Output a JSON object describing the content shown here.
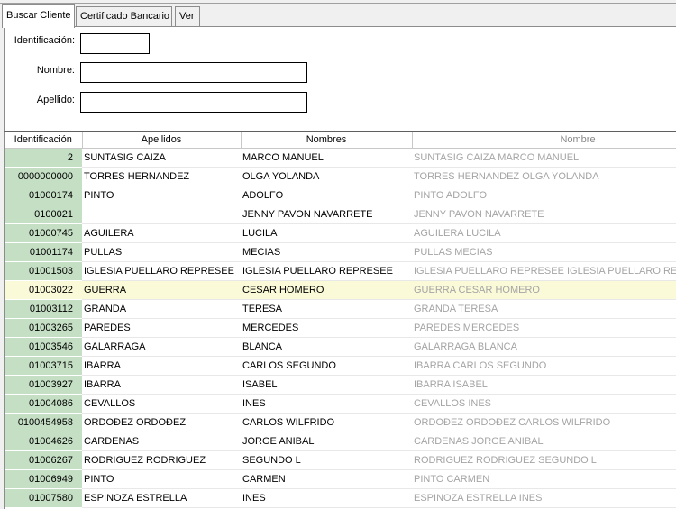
{
  "tabs": [
    {
      "label": "Buscar Cliente",
      "active": true
    },
    {
      "label": "Certificado Bancario",
      "active": false
    },
    {
      "label": "Ver",
      "active": false
    }
  ],
  "form": {
    "identificacion_label": "Identificación:",
    "identificacion_value": "",
    "nombre_label": "Nombre:",
    "nombre_value": "",
    "apellido_label": "Apellido:",
    "apellido_value": ""
  },
  "grid": {
    "headers": [
      "Identificación",
      "Apellidos",
      "Nombres",
      "Nombre"
    ],
    "selected_index": 7,
    "rows": [
      [
        "2",
        "SUNTASIG CAIZA",
        "MARCO MANUEL",
        "SUNTASIG CAIZA MARCO MANUEL"
      ],
      [
        "0000000000",
        "TORRES HERNANDEZ",
        "OLGA YOLANDA",
        "TORRES HERNANDEZ OLGA YOLANDA"
      ],
      [
        "01000174",
        "PINTO",
        "ADOLFO",
        "PINTO  ADOLFO"
      ],
      [
        "0100021",
        "",
        "JENNY PAVON NAVARRETE",
        " JENNY PAVON NAVARRETE"
      ],
      [
        "01000745",
        "AGUILERA",
        "LUCILA",
        "AGUILERA  LUCILA"
      ],
      [
        "01001174",
        "PULLAS",
        "MECIAS",
        "PULLAS  MECIAS"
      ],
      [
        "01001503",
        "IGLESIA PUELLARO REPRESEE",
        "IGLESIA PUELLARO REPRESEE",
        "IGLESIA PUELLARO REPRESEE IGLESIA PUELLARO REPRESEE"
      ],
      [
        "01003022",
        "GUERRA",
        "CESAR HOMERO",
        "GUERRA  CESAR HOMERO"
      ],
      [
        "01003112",
        "GRANDA",
        "TERESA",
        "GRANDA  TERESA"
      ],
      [
        "01003265",
        "PAREDES",
        "MERCEDES",
        "PAREDES  MERCEDES"
      ],
      [
        "01003546",
        "GALARRAGA",
        "BLANCA",
        "GALARRAGA  BLANCA"
      ],
      [
        "01003715",
        "IBARRA",
        "CARLOS SEGUNDO",
        "IBARRA  CARLOS SEGUNDO"
      ],
      [
        "01003927",
        "IBARRA",
        "ISABEL",
        "IBARRA  ISABEL"
      ],
      [
        "01004086",
        "CEVALLOS",
        "INES",
        "CEVALLOS  INES"
      ],
      [
        "0100454958",
        "ORDOĐEZ ORDOĐEZ",
        "CARLOS WILFRIDO",
        "ORDOĐEZ ORDOĐEZ CARLOS WILFRIDO"
      ],
      [
        "01004626",
        "CARDENAS",
        "JORGE ANIBAL",
        "CARDENAS  JORGE ANIBAL"
      ],
      [
        "01006267",
        "RODRIGUEZ RODRIGUEZ",
        "SEGUNDO L",
        "RODRIGUEZ RODRIGUEZ SEGUNDO L"
      ],
      [
        "01006949",
        "PINTO",
        "CARMEN",
        "PINTO  CARMEN"
      ],
      [
        "01007580",
        "ESPINOZA ESTRELLA",
        "INES",
        "ESPINOZA ESTRELLA INES"
      ]
    ]
  }
}
